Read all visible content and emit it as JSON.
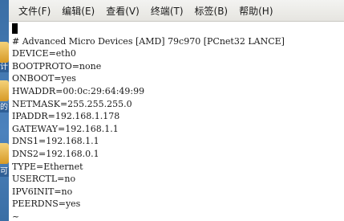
{
  "desktop": {
    "icon_labels": [
      "计",
      "的",
      "可"
    ]
  },
  "menu": {
    "items": [
      "文件(F)",
      "编辑(E)",
      "查看(V)",
      "终端(T)",
      "标签(B)",
      "帮助(H)"
    ]
  },
  "editor": {
    "lines": [
      "# Advanced Micro Devices [AMD] 79c970 [PCnet32 LANCE]",
      "DEVICE=eth0",
      "BOOTPROTO=none",
      "ONBOOT=yes",
      "HWADDR=00:0c:29:64:49:99",
      "NETMASK=255.255.255.0",
      "IPADDR=192.168.1.178",
      "GATEWAY=192.168.1.1",
      "DNS1=192.168.1.1",
      "DNS2=192.168.0.1",
      "TYPE=Ethernet",
      "USERCTL=no",
      "IPV6INIT=no",
      "PEERDNS=yes",
      "~"
    ]
  }
}
